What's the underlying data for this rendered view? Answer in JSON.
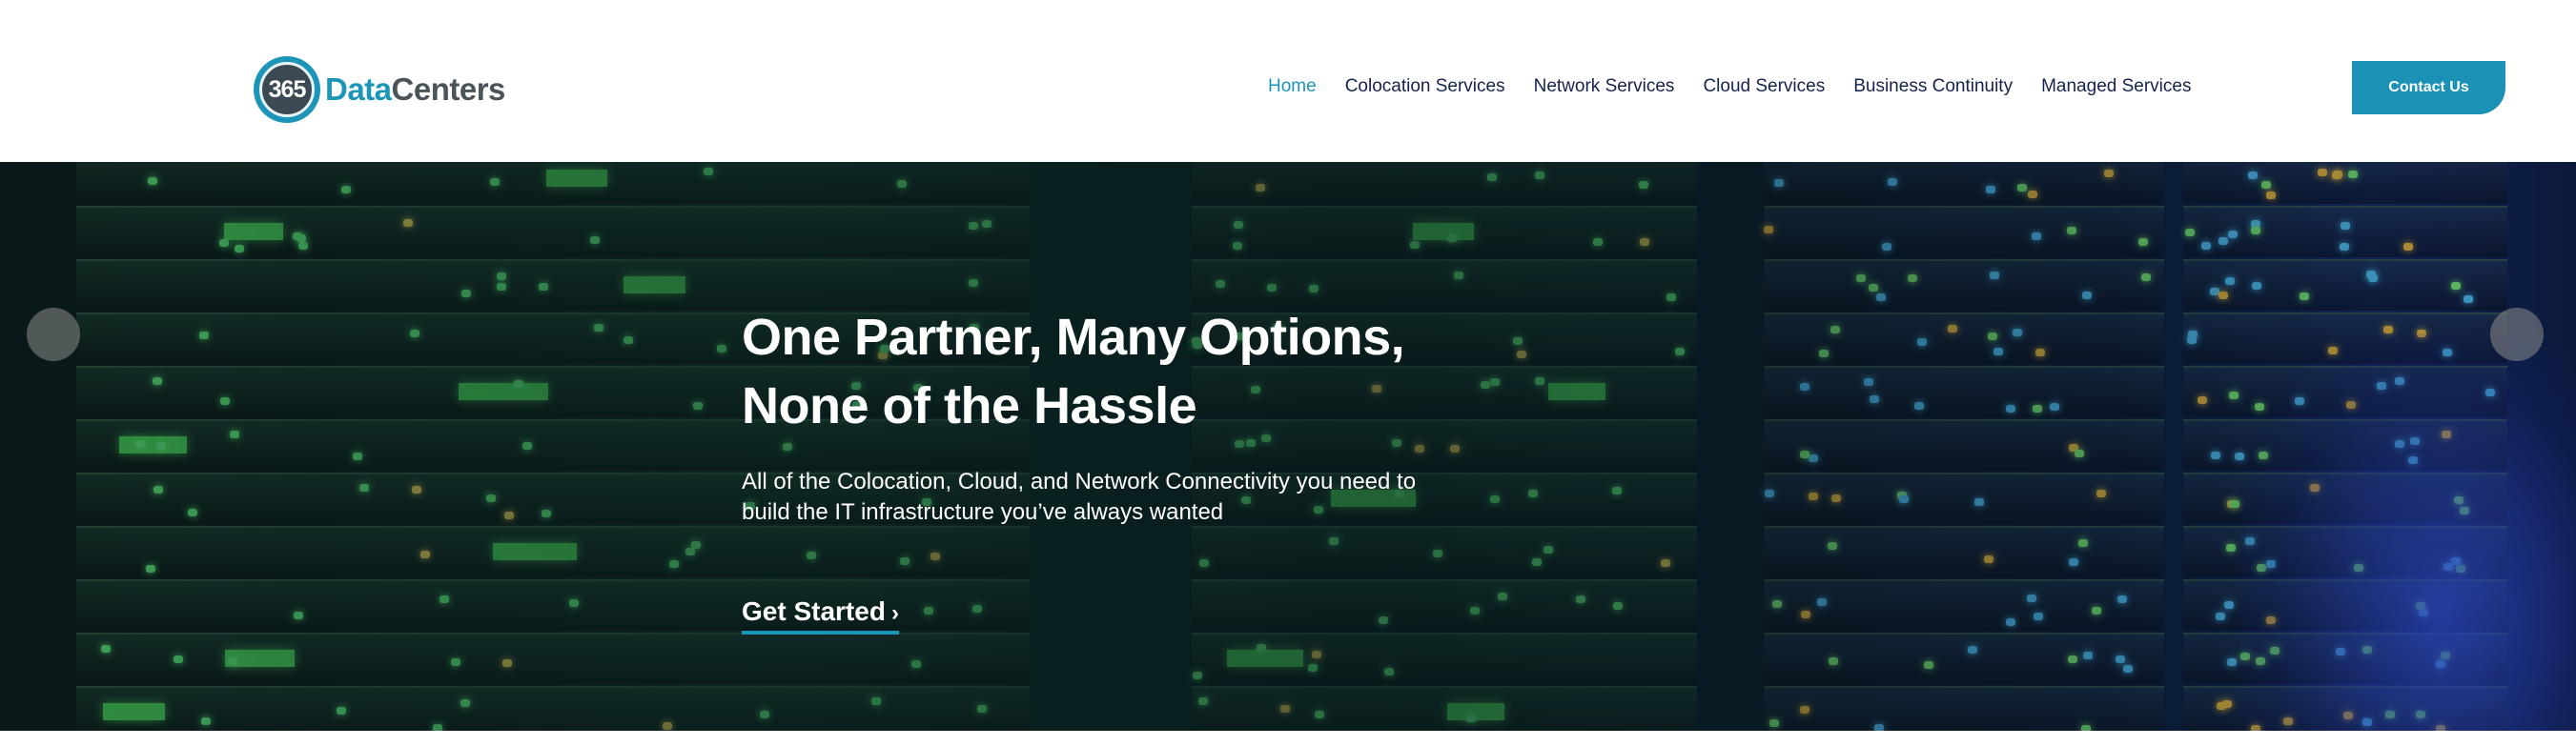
{
  "brand": {
    "badge_number": "365",
    "name_part1": "Data",
    "name_part2": "Centers",
    "colors": {
      "accent": "#1d95b8",
      "dark": "#4a5459",
      "nav": "#15224a"
    }
  },
  "nav": {
    "items": [
      {
        "label": "Home",
        "active": true
      },
      {
        "label": "Colocation Services",
        "active": false
      },
      {
        "label": "Network Services",
        "active": false
      },
      {
        "label": "Cloud Services",
        "active": false
      },
      {
        "label": "Business Continuity",
        "active": false
      },
      {
        "label": "Managed Services",
        "active": false
      }
    ]
  },
  "header": {
    "contact_label": "Contact Us"
  },
  "hero": {
    "title_line1": "One Partner, Many Options,",
    "title_line2": "None of the Hassle",
    "subtitle_line1": "All of the Colocation, Cloud, and Network Connectivity you need to",
    "subtitle_line2": "build the IT infrastructure you’ve always wanted",
    "cta_label": "Get Started",
    "cta_icon": "chevron-right-icon",
    "cta_glyph": "›",
    "background": "server-racks-image"
  }
}
